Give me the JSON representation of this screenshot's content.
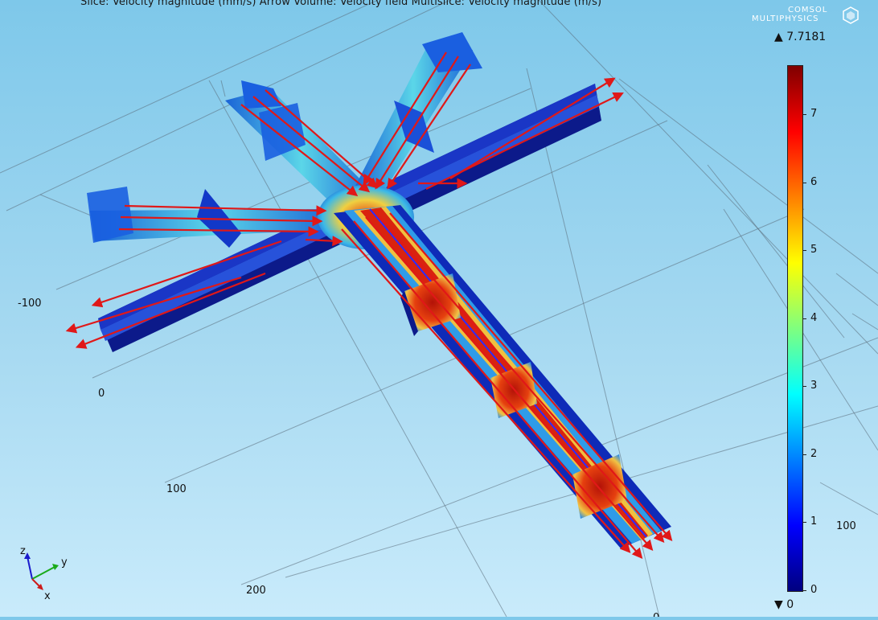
{
  "plot": {
    "title": "Slice: Velocity magnitude (mm/s)  Arrow Volume: Velocity field  Multislice: Velocity magnitude (m/s)",
    "logo": {
      "line1": "COMSOL",
      "line2": "MULTIPHYSICS",
      "icon": "comsol-logo-icon"
    }
  },
  "axis_ticks": [
    "-100",
    "0",
    "100",
    "200",
    "100",
    "0"
  ],
  "colorbar": {
    "max_label": "▲ 7.7181",
    "min_label": "▼ 0",
    "ticks": [
      "0",
      "1",
      "2",
      "3",
      "4",
      "5",
      "6",
      "7"
    ],
    "max": 7.7181,
    "min": 0
  },
  "triad": {
    "z": "z",
    "y": "y",
    "x": "x"
  },
  "colors": {
    "arrow": "#e01818",
    "channel_low": "#0c1a8a",
    "channel_high": "#c81400",
    "background_top": "#7ec8ea"
  }
}
